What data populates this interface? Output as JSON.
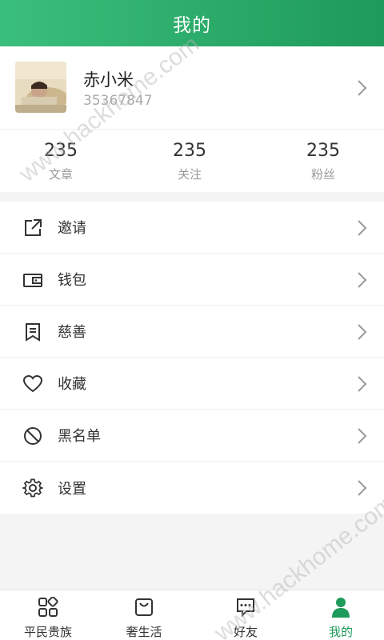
{
  "header": {
    "title": "我的"
  },
  "profile": {
    "name": "赤小米",
    "id": "35367847"
  },
  "stats": [
    {
      "value": "235",
      "label": "文章"
    },
    {
      "value": "235",
      "label": "关注"
    },
    {
      "value": "235",
      "label": "粉丝"
    }
  ],
  "menu": [
    {
      "label": "邀请",
      "icon": "share-icon"
    },
    {
      "label": "钱包",
      "icon": "wallet-icon"
    },
    {
      "label": "慈善",
      "icon": "bookmark-icon"
    },
    {
      "label": "收藏",
      "icon": "heart-icon"
    },
    {
      "label": "黑名单",
      "icon": "block-icon"
    },
    {
      "label": "设置",
      "icon": "gear-icon"
    }
  ],
  "tabs": [
    {
      "label": "平民贵族",
      "icon": "grid-icon"
    },
    {
      "label": "奢生活",
      "icon": "bag-icon"
    },
    {
      "label": "好友",
      "icon": "chat-icon"
    },
    {
      "label": "我的",
      "icon": "person-icon",
      "active": true
    }
  ],
  "watermark": "www.hackhome.com",
  "colors": {
    "primary": "#1e9a5a",
    "header_start": "#3bbf7c"
  }
}
